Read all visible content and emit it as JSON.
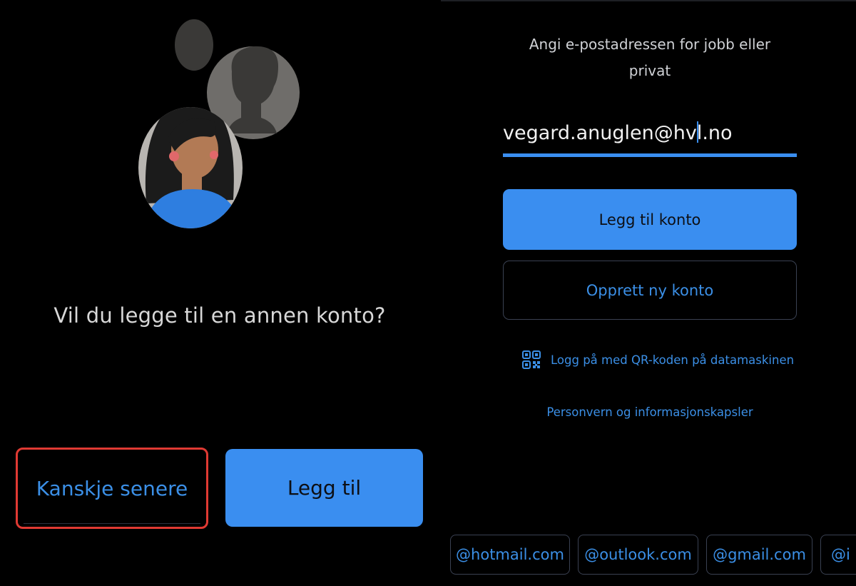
{
  "left_panel": {
    "question": "Vil du legge til en annen konto?",
    "later_button": "Kanskje senere",
    "add_button": "Legg til"
  },
  "right_panel": {
    "prompt": "Angi e-postadressen for jobb eller privat",
    "email_value": "vegard.anuglen@hvl.no",
    "add_account_button": "Legg til konto",
    "create_account_button": "Opprett ny konto",
    "qr_login_link": "Logg på med QR-koden på datamaskinen",
    "privacy_link": "Personvern og informasjonskapsler",
    "domain_suggestions": [
      "@hotmail.com",
      "@outlook.com",
      "@gmail.com",
      "@i"
    ]
  },
  "colors": {
    "background": "#000000",
    "accent": "#3a8ef0",
    "link": "#3b8fe6",
    "highlight_border": "#e03a33"
  }
}
